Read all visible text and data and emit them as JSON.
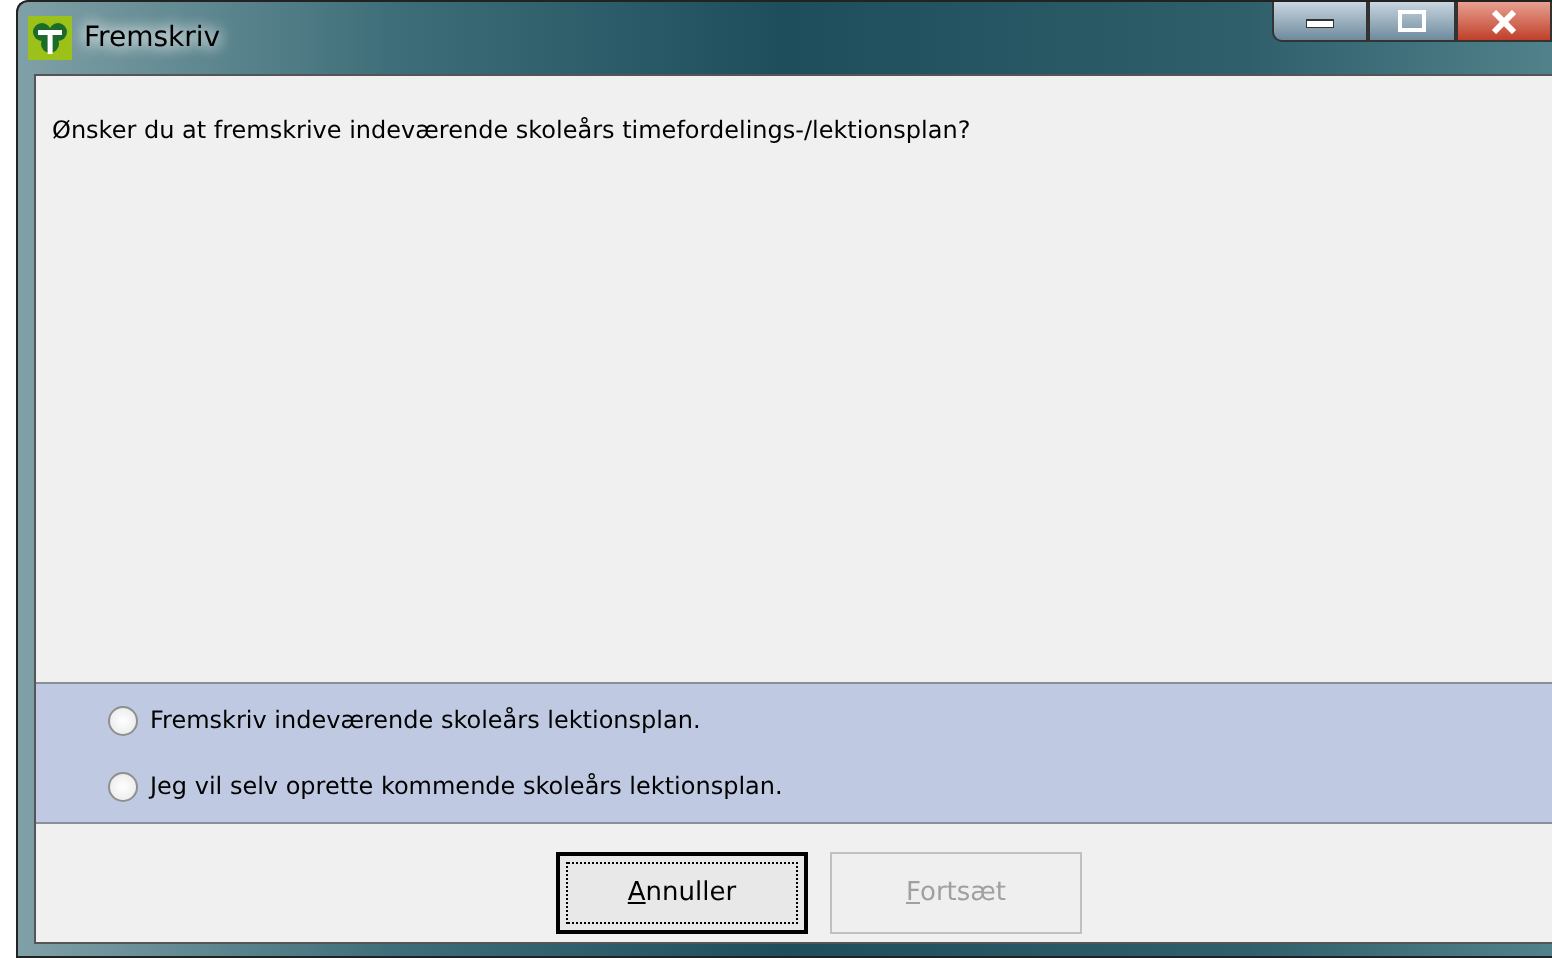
{
  "window": {
    "title": "Fremskriv"
  },
  "question": "Ønsker du at fremskrive indeværende skoleårs timefordelings-/lektionsplan?",
  "options": [
    {
      "label": "Fremskriv indeværende skoleårs lektionsplan.",
      "selected": false
    },
    {
      "label": "Jeg vil selv oprette kommende skoleårs lektionsplan.",
      "selected": false
    }
  ],
  "buttons": [
    {
      "label": "Annuller",
      "underline_first": true,
      "disabled": false,
      "focused": true
    },
    {
      "label": "Fortsæt",
      "underline_first": true,
      "disabled": true,
      "focused": false
    }
  ]
}
